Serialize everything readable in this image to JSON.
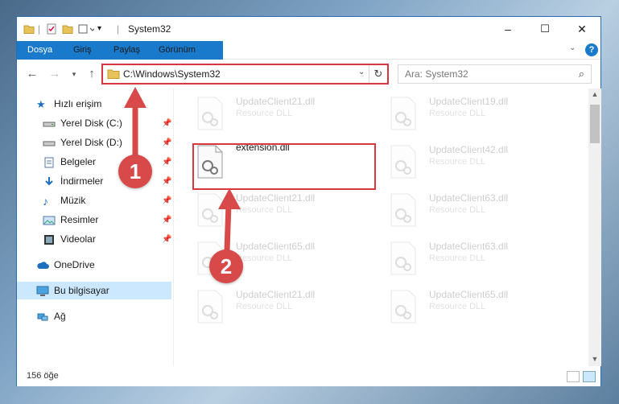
{
  "window": {
    "title": "System32",
    "controls": {
      "minimize": "–",
      "maximize": "☐",
      "close": "✕"
    }
  },
  "ribbon": {
    "tabs": [
      "Dosya",
      "Giriş",
      "Paylaş",
      "Görünüm"
    ],
    "help": "?"
  },
  "address_bar": {
    "path": "C:\\Windows\\System32",
    "search_placeholder": "Ara: System32"
  },
  "nav_pane": {
    "quick_access": "Hızlı erişim",
    "items": [
      {
        "label": "Yerel Disk (C:)",
        "icon": "drive-icon",
        "pinned": true
      },
      {
        "label": "Yerel Disk (D:)",
        "icon": "drive-icon",
        "pinned": true
      },
      {
        "label": "Belgeler",
        "icon": "documents-icon",
        "pinned": true
      },
      {
        "label": "İndirmeler",
        "icon": "download-icon",
        "pinned": true
      },
      {
        "label": "Müzik",
        "icon": "music-icon",
        "pinned": true
      },
      {
        "label": "Resimler",
        "icon": "pictures-icon",
        "pinned": true
      },
      {
        "label": "Videolar",
        "icon": "videos-icon",
        "pinned": true
      }
    ],
    "onedrive": "OneDrive",
    "this_pc": "Bu bilgisayar",
    "network": "Ağ"
  },
  "files": [
    {
      "name": "UpdateClient21.dll",
      "type": "Resource DLL",
      "faded": true
    },
    {
      "name": "UpdateClient19.dll",
      "type": "Resource DLL",
      "faded": true
    },
    {
      "name": "extension.dll",
      "type": "",
      "faded": false
    },
    {
      "name": "UpdateClient42.dll",
      "type": "Resource DLL",
      "faded": true
    },
    {
      "name": "UpdateClient21.dll",
      "type": "Resource DLL",
      "faded": true
    },
    {
      "name": "UpdateClient63.dll",
      "type": "Resource DLL",
      "faded": true
    },
    {
      "name": "UpdateClient65.dll",
      "type": "Resource DLL",
      "faded": true
    },
    {
      "name": "UpdateClient63.dll",
      "type": "Resource DLL",
      "faded": true
    },
    {
      "name": "UpdateClient21.dll",
      "type": "Resource DLL",
      "faded": true
    },
    {
      "name": "UpdateClient65.dll",
      "type": "Resource DLL",
      "faded": true
    }
  ],
  "status_bar": {
    "count": "156 öğe"
  },
  "annotations": {
    "step1": "1",
    "step2": "2",
    "color": "#d84a4a"
  }
}
